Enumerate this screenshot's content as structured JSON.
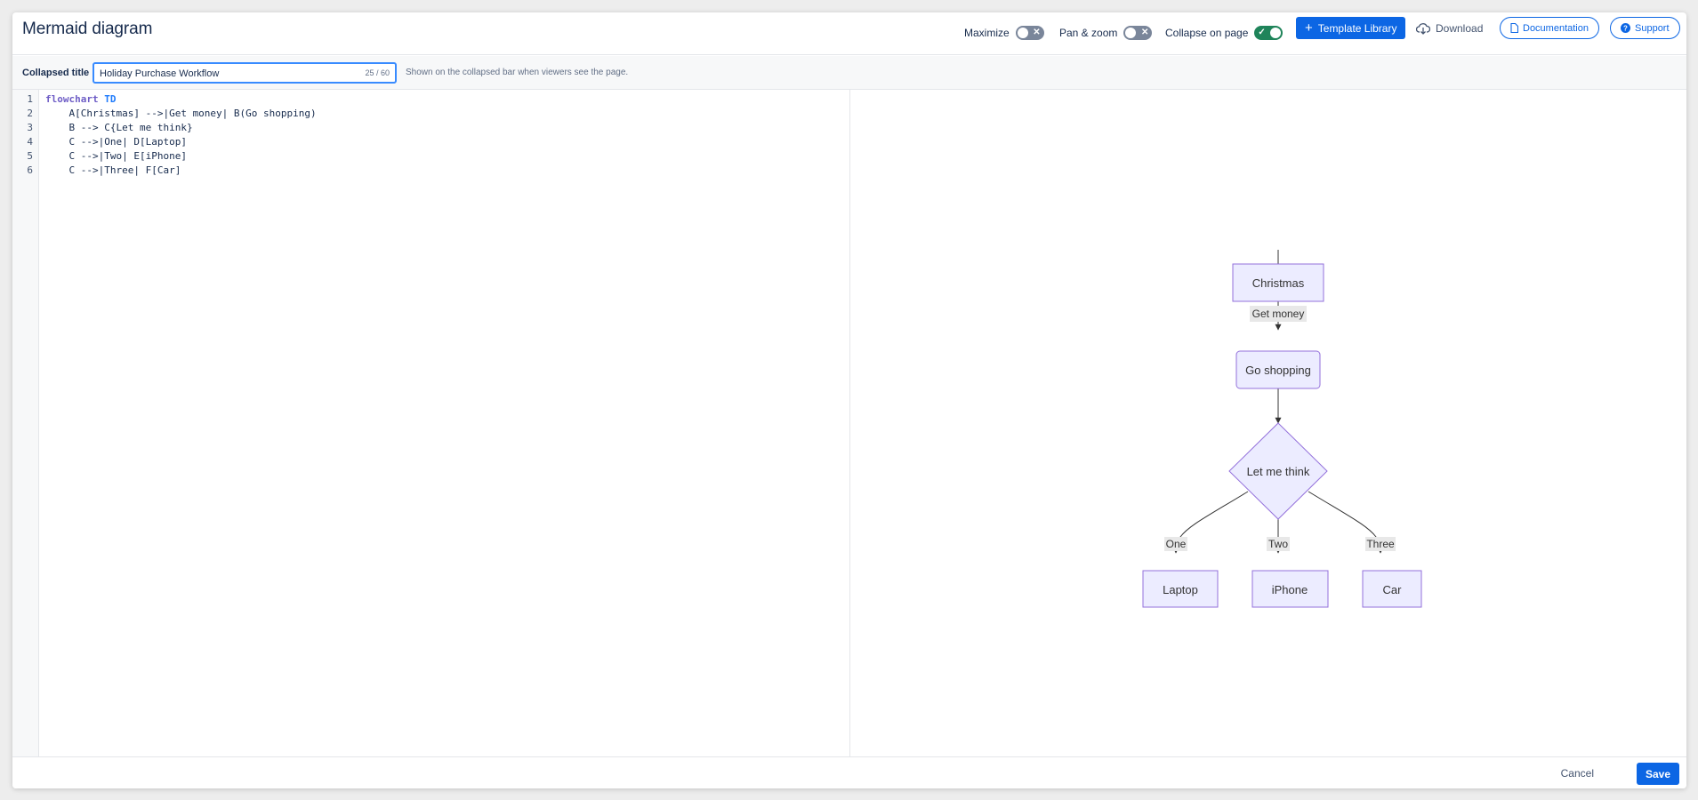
{
  "header": {
    "title": "Mermaid diagram",
    "maximize_label": "Maximize",
    "maximize_on": false,
    "panzoom_label": "Pan & zoom",
    "panzoom_on": false,
    "collapse_label": "Collapse on page",
    "collapse_on": true,
    "template_library_label": "Template Library",
    "download_label": "Download",
    "documentation_label": "Documentation",
    "support_label": "Support"
  },
  "collapsed_title": {
    "label": "Collapsed title",
    "value": "Holiday Purchase Workflow",
    "counter": "25 / 60",
    "help": "Shown on the collapsed bar when viewers see the page."
  },
  "editor": {
    "lines": [
      {
        "num": "1",
        "keyword": "flowchart",
        "keyword2": "TD",
        "text": ""
      },
      {
        "num": "2",
        "keyword": "",
        "keyword2": "",
        "text": "    A[Christmas] -->|Get money| B(Go shopping)"
      },
      {
        "num": "3",
        "keyword": "",
        "keyword2": "",
        "text": "    B --> C{Let me think}"
      },
      {
        "num": "4",
        "keyword": "",
        "keyword2": "",
        "text": "    C -->|One| D[Laptop]"
      },
      {
        "num": "5",
        "keyword": "",
        "keyword2": "",
        "text": "    C -->|Two| E[iPhone]"
      },
      {
        "num": "6",
        "keyword": "",
        "keyword2": "",
        "text": "    C -->|Three| F[Car]"
      }
    ]
  },
  "diagram": {
    "nodes": {
      "A": "Christmas",
      "B": "Go shopping",
      "C": "Let me think",
      "D": "Laptop",
      "E": "iPhone",
      "F": "Car"
    },
    "edge_labels": {
      "AB": "Get money",
      "CD": "One",
      "CE": "Two",
      "CF": "Three"
    },
    "colors": {
      "node_fill": "#ececff",
      "node_stroke": "#9370db",
      "edge": "#333333",
      "edge_label_bg": "#e8e8e8"
    }
  },
  "footer": {
    "cancel_label": "Cancel",
    "save_label": "Save"
  },
  "colors": {
    "primary": "#0c66e4",
    "toggle_on": "#1f845a",
    "toggle_off": "#7a869a"
  }
}
